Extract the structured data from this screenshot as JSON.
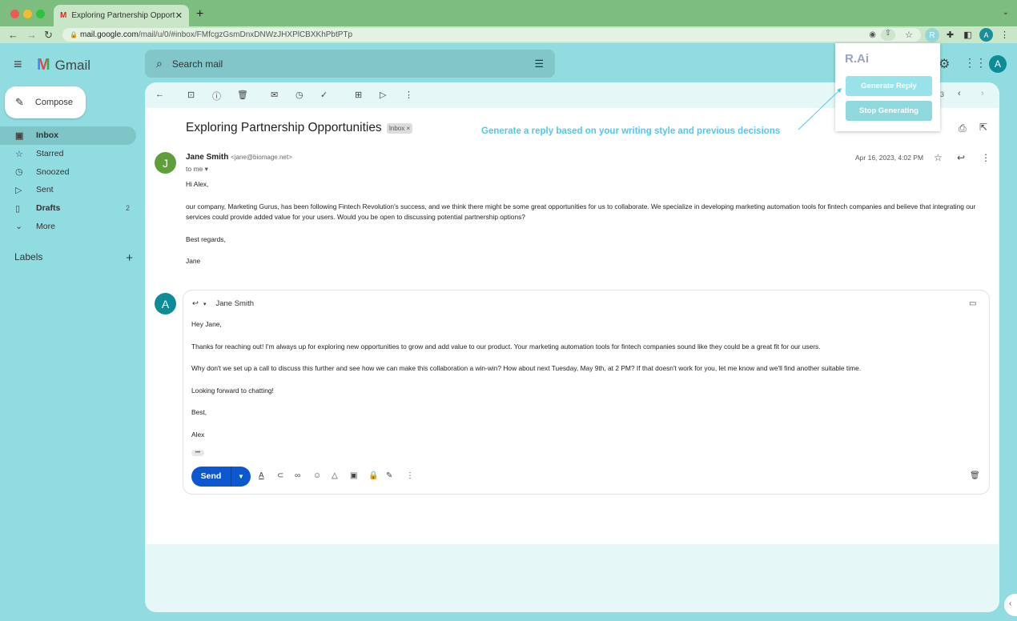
{
  "browser": {
    "tab_title": "Exploring Partnership Opportunities",
    "url_host": "mail.google.com",
    "url_path": "/mail/u/0/#inbox/FMfcgzGsmDnxDNWzJHXPlCBXKhPbtPTp",
    "new_tab_label": "+",
    "extension_badge": "R",
    "profile_initial": "A"
  },
  "gmail": {
    "logo_text": "Gmail",
    "search_placeholder": "Search mail",
    "compose_label": "Compose",
    "account_initial": "A",
    "nav": [
      {
        "label": "Inbox",
        "icon": "inbox-icon",
        "count": ""
      },
      {
        "label": "Starred",
        "icon": "star-icon",
        "count": ""
      },
      {
        "label": "Snoozed",
        "icon": "clock-icon",
        "count": ""
      },
      {
        "label": "Sent",
        "icon": "send-icon",
        "count": ""
      },
      {
        "label": "Drafts",
        "icon": "draft-icon",
        "count": "2"
      },
      {
        "label": "More",
        "icon": "chevron-down-icon",
        "count": ""
      }
    ],
    "labels_heading": "Labels",
    "pagination_text": "3"
  },
  "email": {
    "subject": "Exploring Partnership Opportunities",
    "label_badge": "Inbox ×",
    "sender_initial": "J",
    "sender_name": "Jane Smith",
    "sender_email": "<jane@biomage.net>",
    "to_line": "to me",
    "date": "Apr 16, 2023, 4:02 PM",
    "body": [
      "Hi Alex,",
      "our company, Marketing Gurus, has been following Fintech Revolution's success, and we think there might be some great opportunities for us to collaborate. We specialize in developing marketing automation tools for fintech companies and believe that integrating our services could provide added value for your users. Would you be open to discussing potential partnership options?",
      "Best regards,",
      "Jane"
    ]
  },
  "reply": {
    "avatar_initial": "A",
    "recipient": "Jane Smith",
    "body": [
      "Hey Jane,",
      "Thanks for reaching out! I'm always up for exploring new opportunities to grow and add value to our product. Your marketing automation tools for fintech companies sound like they could be a great fit for our users.",
      "Why don't we set up a call to discuss this further and see how we can make this collaboration a win-win? How about next Tuesday, May 9th, at 2 PM? If that doesn't work for you, let me know and we'll find another suitable time.",
      "Looking forward to chatting!",
      "Best,",
      "Alex"
    ],
    "ellipsis": "•••",
    "send_label": "Send"
  },
  "extension": {
    "title": "R.Ai",
    "generate_label": "Generate Reply",
    "stop_label": "Stop Generating",
    "annotation": "Generate a reply based on your writing style and previous decisions",
    "colors": {
      "generate": "#98e3ea",
      "stop": "#8ed8de",
      "annotation": "#4fc7ee"
    }
  }
}
